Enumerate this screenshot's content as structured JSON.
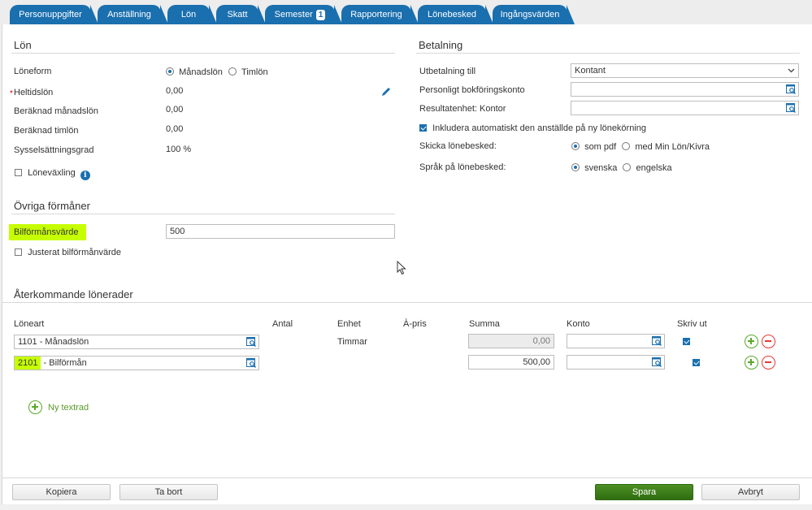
{
  "tabs": [
    {
      "label": "Personuppgifter"
    },
    {
      "label": "Anställning"
    },
    {
      "label": "Lön"
    },
    {
      "label": "Skatt"
    },
    {
      "label": "Semester",
      "badge": "1"
    },
    {
      "label": "Rapportering"
    },
    {
      "label": "Lönebesked"
    },
    {
      "label": "Ingångsvärden"
    }
  ],
  "lon": {
    "title": "Lön",
    "loneform_label": "Löneform",
    "loneform_options": [
      "Månadslön",
      "Timlön"
    ],
    "heltidslon_label": "Heltidslön",
    "heltidslon_value": "0,00",
    "ber_manadslon_label": "Beräknad månadslön",
    "ber_manadslon_value": "0,00",
    "ber_timlon_label": "Beräknad timlön",
    "ber_timlon_value": "0,00",
    "syssel_label": "Sysselsättningsgrad",
    "syssel_value": "100 %",
    "lonevaxling_label": "Löneväxling"
  },
  "ovriga": {
    "title": "Övriga förmåner",
    "bilformansvarde_label": "Bilförmånsvärde",
    "bilformansvarde_value": "500",
    "justerat_label": "Justerat bilförmånvärde"
  },
  "betalning": {
    "title": "Betalning",
    "utbetalning_label": "Utbetalning till",
    "utbetalning_value": "Kontant",
    "bokforing_label": "Personligt bokföringskonto",
    "resultat_label": "Resultatenhet: Kontor",
    "inkludera_label": "Inkludera automatiskt den anställde på ny lönekörning",
    "skicka_label": "Skicka lönebesked:",
    "skicka_options": [
      "som pdf",
      "med Min Lön/Kivra"
    ],
    "sprak_label": "Språk på lönebesked:",
    "sprak_options": [
      "svenska",
      "engelska"
    ]
  },
  "recurring": {
    "title": "Återkommande lönerader",
    "headers": [
      "Löneart",
      "Antal",
      "Enhet",
      "À-pris",
      "Summa",
      "Konto",
      "Skriv ut"
    ],
    "rows": [
      {
        "loneart": "1101 - Månadslön",
        "enhet": "Timmar",
        "summa": "0,00"
      },
      {
        "loneart_code": "2101",
        "loneart_rest": " - Bilförmån",
        "enhet": "",
        "summa": "500,00"
      }
    ],
    "ny_textrad": "Ny textrad"
  },
  "footer": {
    "kopiera": "Kopiera",
    "ta_bort": "Ta bort",
    "spara": "Spara",
    "avbryt": "Avbryt"
  },
  "colors": {
    "accent": "#1a6fae",
    "primary_button": "#3b7a18",
    "highlight": "#c6ff00"
  }
}
